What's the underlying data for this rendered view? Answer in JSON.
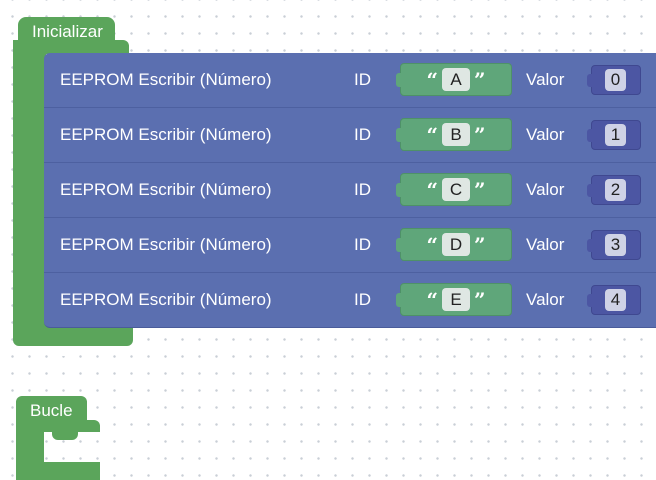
{
  "workspace": {
    "inicializar": {
      "label": "Inicializar",
      "blocks": [
        {
          "label": "EEPROM Escribir (Número)",
          "id_label": "ID",
          "id_value": "A",
          "valor_label": "Valor",
          "valor_value": "0"
        },
        {
          "label": "EEPROM Escribir (Número)",
          "id_label": "ID",
          "id_value": "B",
          "valor_label": "Valor",
          "valor_value": "1"
        },
        {
          "label": "EEPROM Escribir (Número)",
          "id_label": "ID",
          "id_value": "C",
          "valor_label": "Valor",
          "valor_value": "2"
        },
        {
          "label": "EEPROM Escribir (Número)",
          "id_label": "ID",
          "id_value": "D",
          "valor_label": "Valor",
          "valor_value": "3"
        },
        {
          "label": "EEPROM Escribir (Número)",
          "id_label": "ID",
          "id_value": "E",
          "valor_label": "Valor",
          "valor_value": "4"
        }
      ]
    },
    "bucle": {
      "label": "Bucle"
    },
    "colors": {
      "event_block": "#5ba55b",
      "eeprom_block": "#5b6fb0",
      "text_input": "#5fa67a",
      "number_input": "#4c56a3"
    },
    "quote_open": "“",
    "quote_close": "”"
  }
}
